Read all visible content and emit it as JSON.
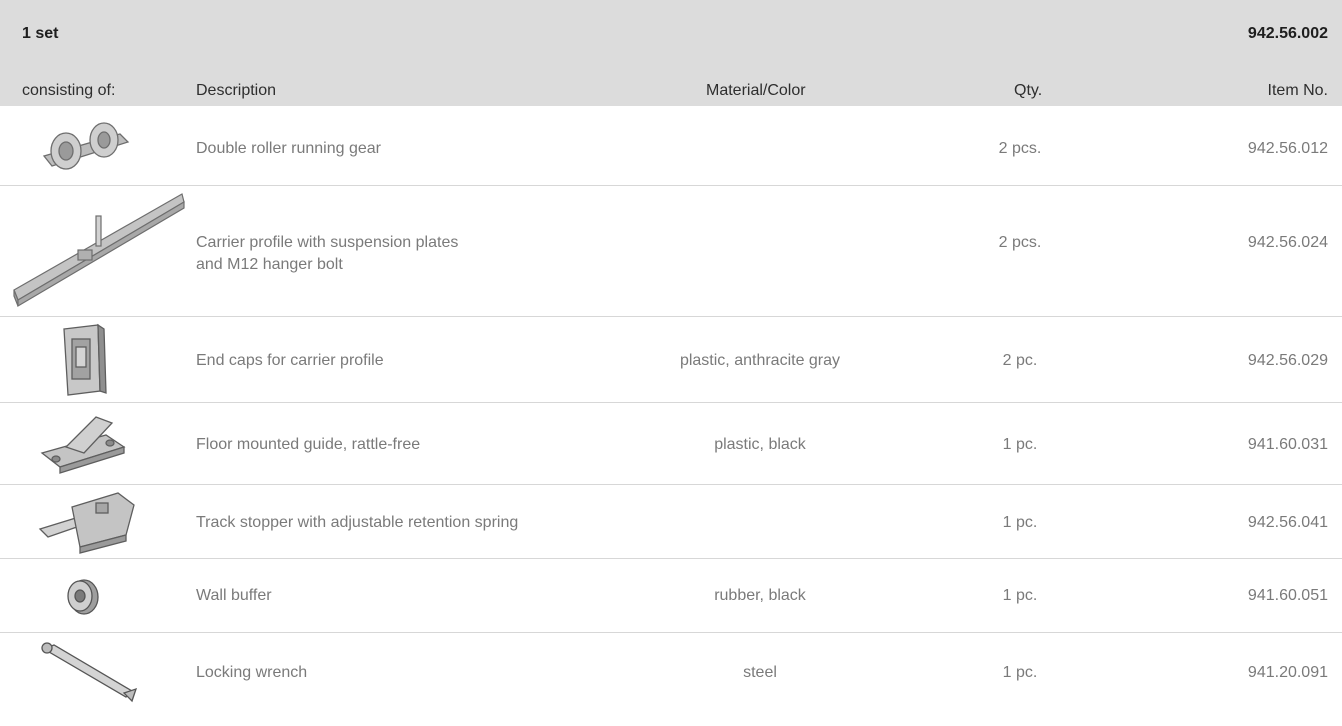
{
  "header": {
    "set_label": "1 set",
    "set_item_no": "942.56.002",
    "columns": {
      "consisting": "consisting of:",
      "description": "Description",
      "material": "Material/Color",
      "qty": "Qty.",
      "item": "Item No."
    }
  },
  "rows": [
    {
      "icon": "double-roller-running-gear-icon",
      "description": [
        "Double roller running gear"
      ],
      "material": "",
      "qty": "2 pcs.",
      "item": "942.56.012"
    },
    {
      "icon": "carrier-profile-icon",
      "description": [
        "Carrier profile with suspension plates",
        "and M12 hanger bolt"
      ],
      "material": "",
      "qty": "2 pcs.",
      "item": "942.56.024"
    },
    {
      "icon": "end-cap-icon",
      "description": [
        "End caps for carrier profile"
      ],
      "material": "plastic, anthracite gray",
      "qty": "2 pc.",
      "item": "942.56.029"
    },
    {
      "icon": "floor-guide-icon",
      "description": [
        "Floor mounted guide, rattle-free"
      ],
      "material": "plastic, black",
      "qty": "1 pc.",
      "item": "941.60.031"
    },
    {
      "icon": "track-stopper-icon",
      "description": [
        "Track stopper with adjustable retention spring"
      ],
      "material": "",
      "qty": "1 pc.",
      "item": "942.56.041"
    },
    {
      "icon": "wall-buffer-icon",
      "description": [
        "Wall buffer"
      ],
      "material": "rubber, black",
      "qty": "1 pc.",
      "item": "941.60.051"
    },
    {
      "icon": "locking-wrench-icon",
      "description": [
        "Locking wrench"
      ],
      "material": "steel",
      "qty": "1 pc.",
      "item": "941.20.091"
    }
  ]
}
